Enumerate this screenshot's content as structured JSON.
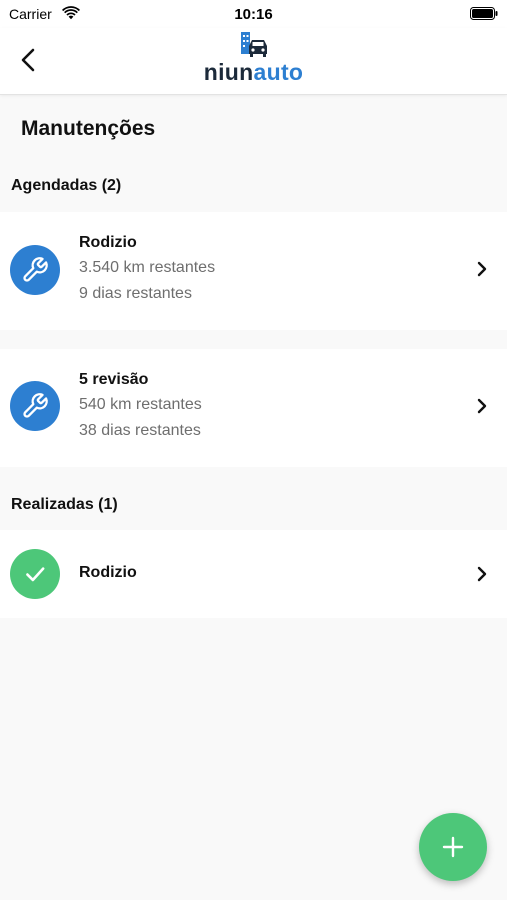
{
  "status_bar": {
    "carrier": "Carrier",
    "time": "10:16",
    "wifi_icon": "wifi-icon",
    "battery_icon": "battery-icon"
  },
  "nav": {
    "back_icon": "chevron-left-icon",
    "logo": {
      "part1": "niun",
      "part2": "auto",
      "color_part1": "#1c2a3a",
      "color_part2": "#2d7fd1"
    }
  },
  "page": {
    "title": "Manutenções"
  },
  "scheduled": {
    "heading": "Agendadas (2)",
    "items": [
      {
        "title": "Rodizio",
        "km": "3.540 km restantes",
        "days": "9 dias restantes",
        "icon": "wrench-icon",
        "icon_color": "#2d7fd1"
      },
      {
        "title": "5 revisão",
        "km": "540 km restantes",
        "days": "38 dias restantes",
        "icon": "wrench-icon",
        "icon_color": "#2d7fd1"
      }
    ]
  },
  "completed": {
    "heading": "Realizadas (1)",
    "items": [
      {
        "title": "Rodizio",
        "icon": "check-icon",
        "icon_color": "#4dc779"
      }
    ]
  },
  "fab": {
    "icon": "plus-icon",
    "color": "#4dc779"
  }
}
